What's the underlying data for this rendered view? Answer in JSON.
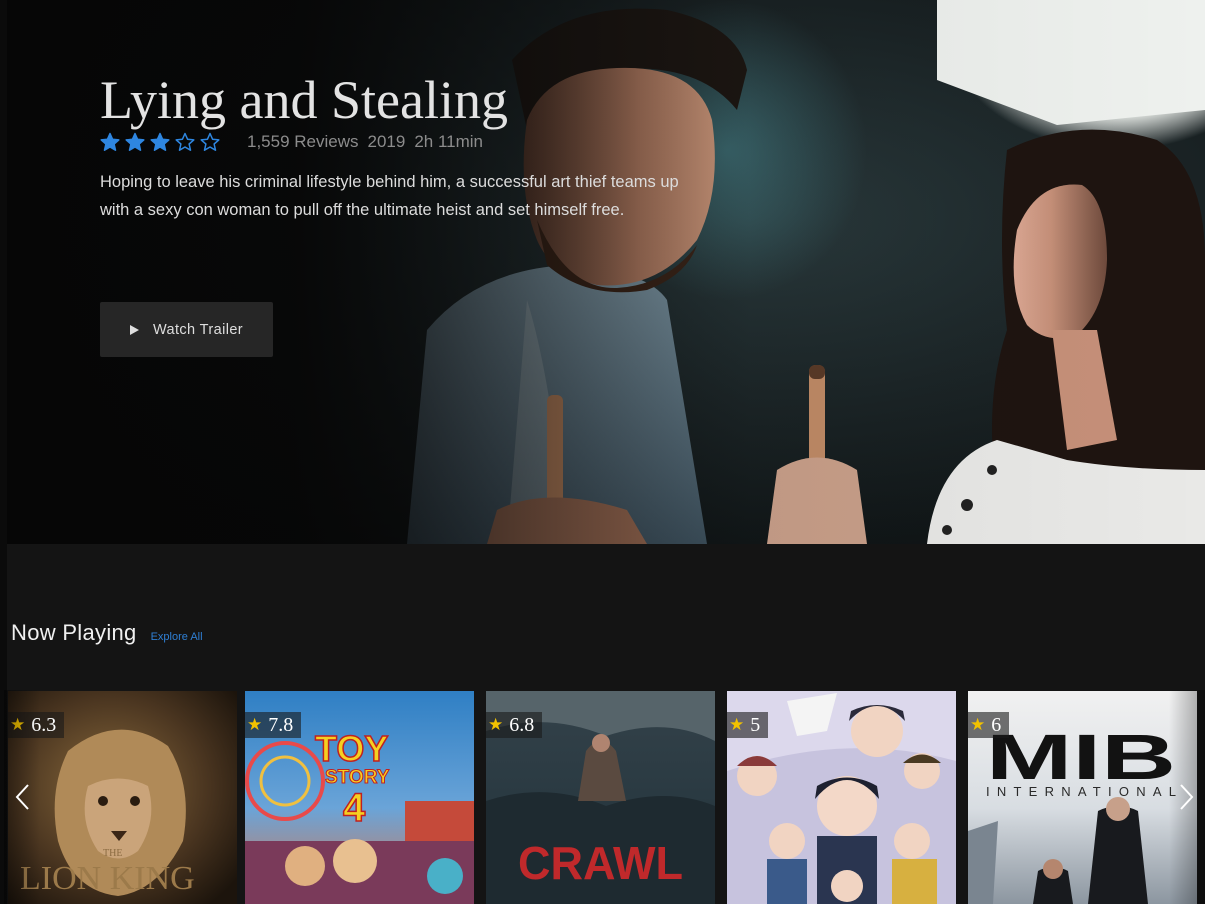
{
  "hero": {
    "title": "Lying and Stealing",
    "rating_stars": 3,
    "rating_max": 5,
    "reviews": "1,559 Reviews",
    "year": "2019",
    "duration": "2h 11min",
    "description": "Hoping to leave his criminal lifestyle behind him, a successful art thief teams up with a sexy con woman to pull off the ultimate heist and set himself free.",
    "trailer_label": "Watch Trailer"
  },
  "section": {
    "title": "Now Playing",
    "explore_label": "Explore All"
  },
  "movies": [
    {
      "rating": "6.3",
      "poster_text": "LION KING",
      "poster_small": "THE"
    },
    {
      "rating": "7.8",
      "poster_text": "TOY",
      "poster_small": "STORY",
      "poster_num": "4"
    },
    {
      "rating": "6.8",
      "poster_text": "CRAWL"
    },
    {
      "rating": "5"
    },
    {
      "rating": "6",
      "poster_text": "MIB",
      "poster_small": "INTERNATIONAL"
    }
  ],
  "colors": {
    "accent": "#2f7fd4",
    "star_rating": "#2e86e0",
    "badge_star": "#f2c200",
    "background": "#141414"
  },
  "icons": {
    "play": "play-icon",
    "prev": "chevron-left-icon",
    "next": "chevron-right-icon",
    "star": "star-icon"
  }
}
